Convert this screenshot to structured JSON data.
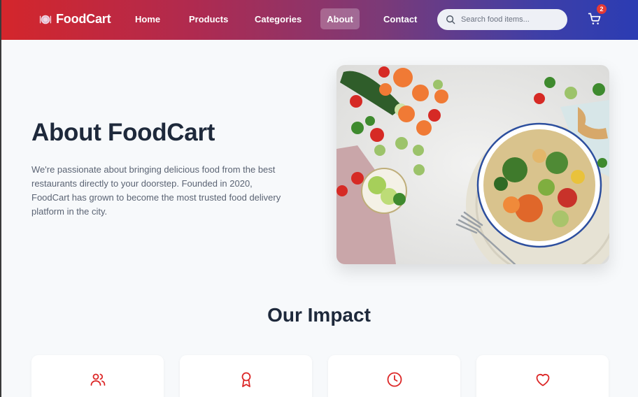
{
  "brand": {
    "name": "FoodCart",
    "logo_icon": "plate-utensils-icon"
  },
  "nav": {
    "links": [
      "Home",
      "Products",
      "Categories",
      "About",
      "Contact"
    ],
    "active": "About"
  },
  "search": {
    "placeholder": "Search food items...",
    "icon": "search-icon"
  },
  "cart": {
    "icon": "shopping-cart-icon",
    "count": "2"
  },
  "hero": {
    "title": "About FoodCart",
    "text": "We're passionate about bringing delicious food from the best restaurants directly to your doorstep. Founded in 2020, FoodCart has grown to become the most trusted food delivery platform in the city.",
    "image": "food-bowl-salad-photo"
  },
  "impact": {
    "title": "Our Impact",
    "cards": [
      {
        "icon": "users-icon"
      },
      {
        "icon": "award-ribbon-icon"
      },
      {
        "icon": "clock-icon"
      },
      {
        "icon": "heart-icon"
      }
    ]
  },
  "colors": {
    "accent": "#dc2626",
    "nav_gradient_start": "#d4262b",
    "nav_gradient_end": "#2b3cb3",
    "heading": "#1e293b",
    "body_text": "#5b6474",
    "background": "#f7f9fb"
  }
}
